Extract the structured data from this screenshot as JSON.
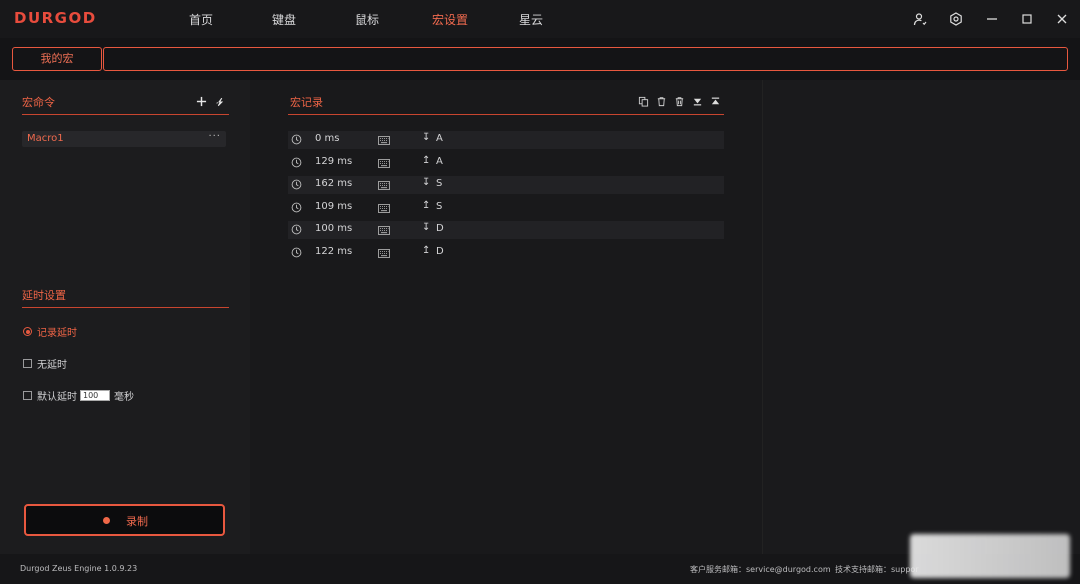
{
  "app": {
    "logo": "DURGOD",
    "nav": [
      {
        "label": "首页"
      },
      {
        "label": "键盘"
      },
      {
        "label": "鼠标"
      },
      {
        "label": "宏设置",
        "active": true
      },
      {
        "label": "星云"
      }
    ],
    "window_icons": [
      "user-icon",
      "settings-icon",
      "minimize-icon",
      "maximize-icon",
      "close-icon"
    ]
  },
  "macro_tab": {
    "label": "我的宏",
    "name_value": ""
  },
  "commands": {
    "title": "宏命令",
    "items": [
      {
        "label": "Macro1",
        "more": "···"
      }
    ]
  },
  "delay": {
    "title": "延时设置",
    "options": [
      {
        "label": "记录延时",
        "type": "radio",
        "selected": true
      },
      {
        "label": "无延时",
        "type": "checkbox",
        "selected": false
      },
      {
        "label": "默认延时",
        "type": "checkbox",
        "selected": false,
        "value": "100",
        "unit": "毫秒"
      }
    ]
  },
  "record_button": {
    "label": "录制"
  },
  "record": {
    "title": "宏记录",
    "events": [
      {
        "time": "0 ms",
        "dir": "↧",
        "key": "A"
      },
      {
        "time": "129 ms",
        "dir": "↥",
        "key": "A"
      },
      {
        "time": "162 ms",
        "dir": "↧",
        "key": "S"
      },
      {
        "time": "109 ms",
        "dir": "↥",
        "key": "S"
      },
      {
        "time": "100 ms",
        "dir": "↧",
        "key": "D"
      },
      {
        "time": "122 ms",
        "dir": "↥",
        "key": "D"
      }
    ]
  },
  "status": {
    "version": "Durgod Zeus Engine 1.0.9.23",
    "service": "客户服务邮箱：service@durgod.com",
    "support": "技术支持邮箱：suppor"
  },
  "colors": {
    "accent": "#e8583f",
    "background": "#111113"
  }
}
